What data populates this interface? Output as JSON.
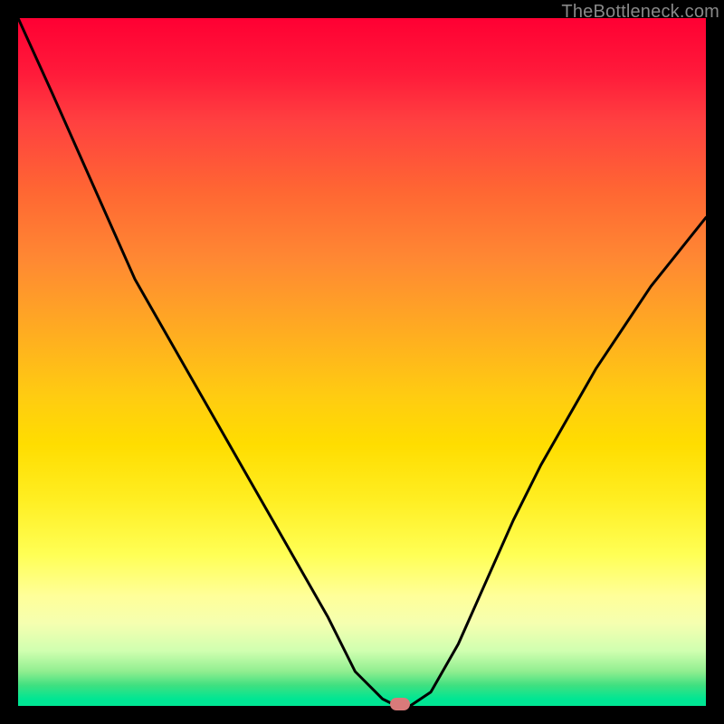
{
  "watermark": "TheBottleneck.com",
  "chart_data": {
    "type": "line",
    "title": "",
    "xlabel": "",
    "ylabel": "",
    "x": [
      0.0,
      0.05,
      0.09,
      0.13,
      0.17,
      0.21,
      0.25,
      0.29,
      0.33,
      0.37,
      0.41,
      0.45,
      0.49,
      0.53,
      0.55,
      0.57,
      0.6,
      0.64,
      0.68,
      0.72,
      0.76,
      0.8,
      0.84,
      0.88,
      0.92,
      0.96,
      1.0
    ],
    "values": [
      1.0,
      0.89,
      0.8,
      0.71,
      0.62,
      0.55,
      0.48,
      0.41,
      0.34,
      0.27,
      0.2,
      0.13,
      0.05,
      0.01,
      0.0,
      0.0,
      0.02,
      0.09,
      0.18,
      0.27,
      0.35,
      0.42,
      0.49,
      0.55,
      0.61,
      0.66,
      0.71
    ],
    "ylim": [
      0,
      1
    ],
    "xlim": [
      0,
      1
    ],
    "background_gradient": [
      "#ff0033",
      "#ff6633",
      "#ffdd00",
      "#ffff99",
      "#00e693"
    ],
    "marker": {
      "x": 0.555,
      "y": 0.0,
      "color": "#d97a7a"
    }
  }
}
